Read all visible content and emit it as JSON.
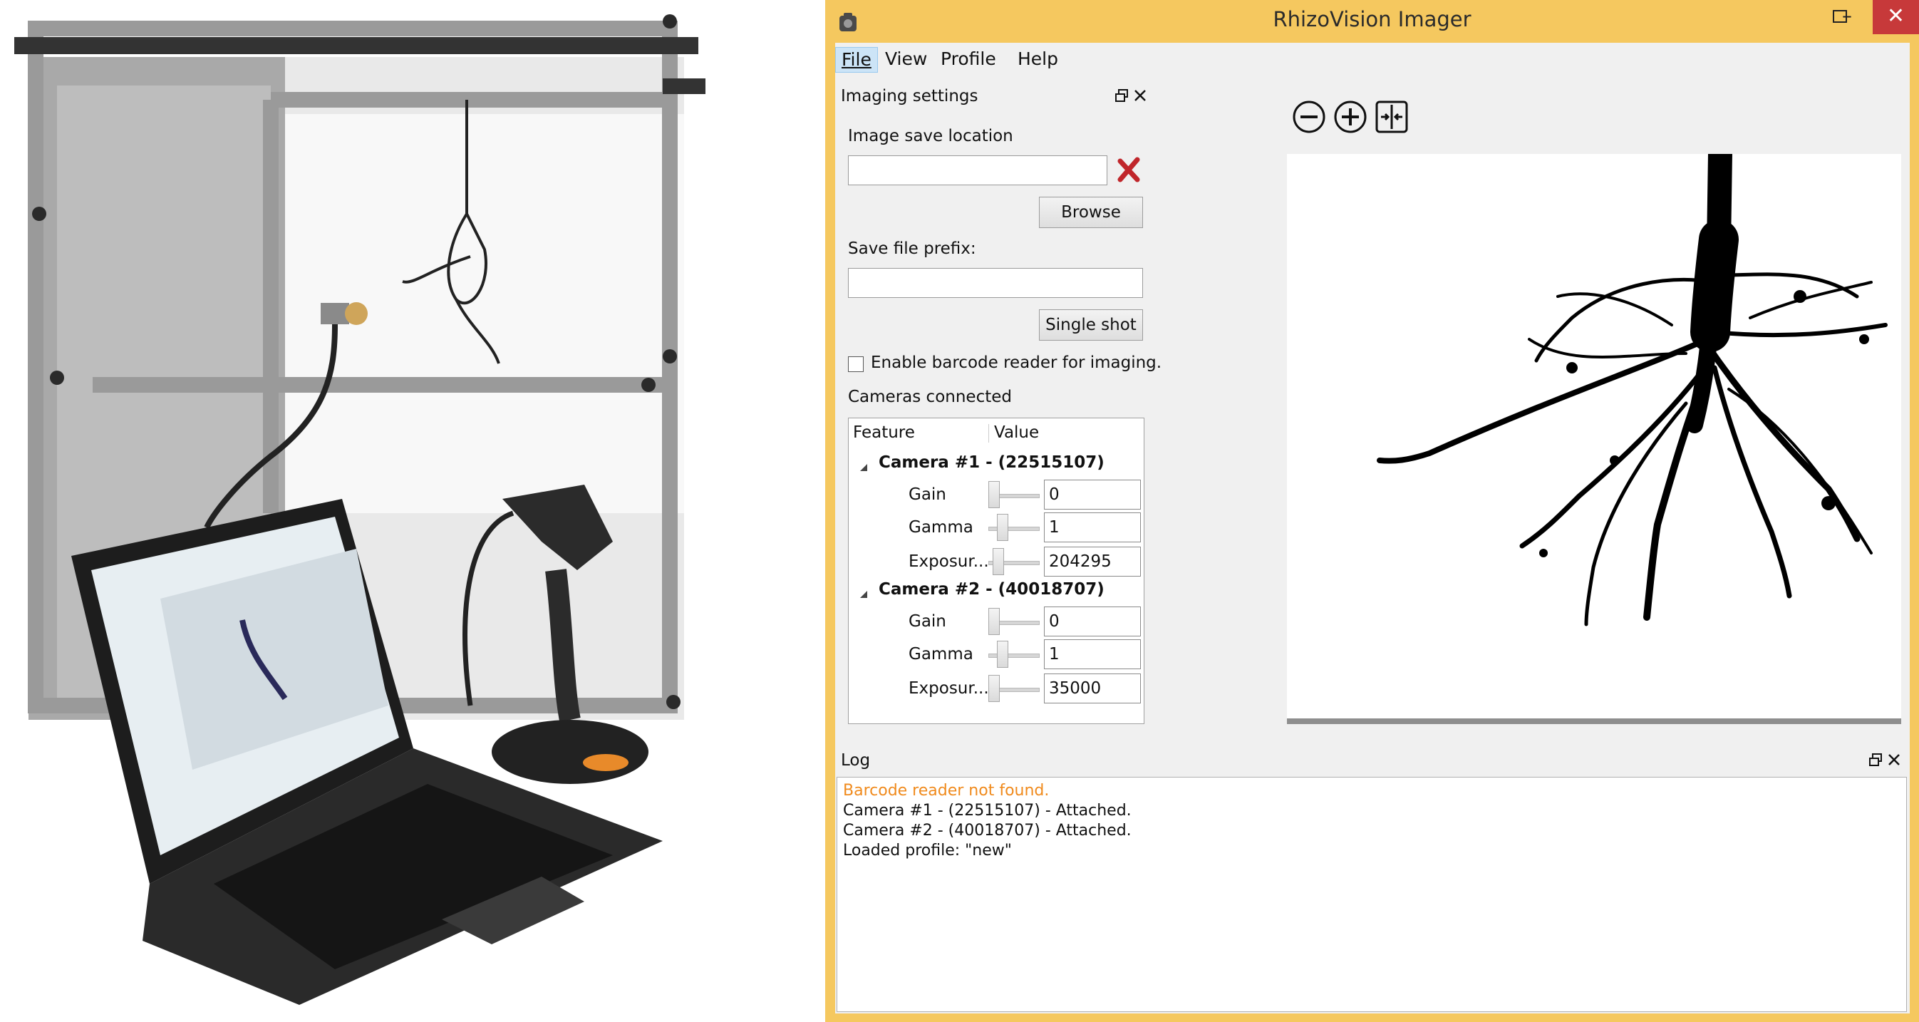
{
  "window": {
    "title": "RhizoVision Imager"
  },
  "window_controls": {
    "minimize": "–",
    "maximize": "□",
    "close": "✕"
  },
  "menu": [
    {
      "label": "File"
    },
    {
      "label": "View"
    },
    {
      "label": "Profile"
    },
    {
      "label": "Help"
    }
  ],
  "imaging": {
    "panel_title": "Imaging settings",
    "save_location_label": "Image save location",
    "save_location_value": "",
    "browse_label": "Browse",
    "prefix_label": "Save file prefix:",
    "prefix_value": "",
    "single_shot_label": "Single shot",
    "barcode_label": "Enable barcode reader for imaging.",
    "barcode_checked": false,
    "cameras_label": "Cameras connected",
    "tree_headers": {
      "feature": "Feature",
      "value": "Value"
    },
    "cameras": [
      {
        "name": "Camera #1 - (22515107)",
        "features": [
          {
            "name": "Gain",
            "value": "0"
          },
          {
            "name": "Gamma",
            "value": "1"
          },
          {
            "name": "Exposur...",
            "value": "204295"
          }
        ]
      },
      {
        "name": "Camera #2 - (40018707)",
        "features": [
          {
            "name": "Gain",
            "value": "0"
          },
          {
            "name": "Gamma",
            "value": "1"
          },
          {
            "name": "Exposur...",
            "value": "35000"
          }
        ]
      }
    ]
  },
  "toolbar": {
    "icons": [
      "zoom-out-icon",
      "zoom-in-icon",
      "fit-to-window-icon"
    ]
  },
  "log": {
    "title": "Log",
    "lines": [
      {
        "text": "Barcode reader not found.",
        "color": "#f08a1c"
      },
      {
        "text": "Camera #1 - (22515107) - Attached.",
        "color": "#111111"
      },
      {
        "text": "Camera #2 - (40018707) - Attached.",
        "color": "#111111"
      },
      {
        "text": "Loaded profile:  \"new\"",
        "color": "#111111"
      }
    ]
  },
  "colors": {
    "window_frame": "#f5c85f",
    "close_button": "#c7393a",
    "warning_text": "#f08a1c"
  }
}
